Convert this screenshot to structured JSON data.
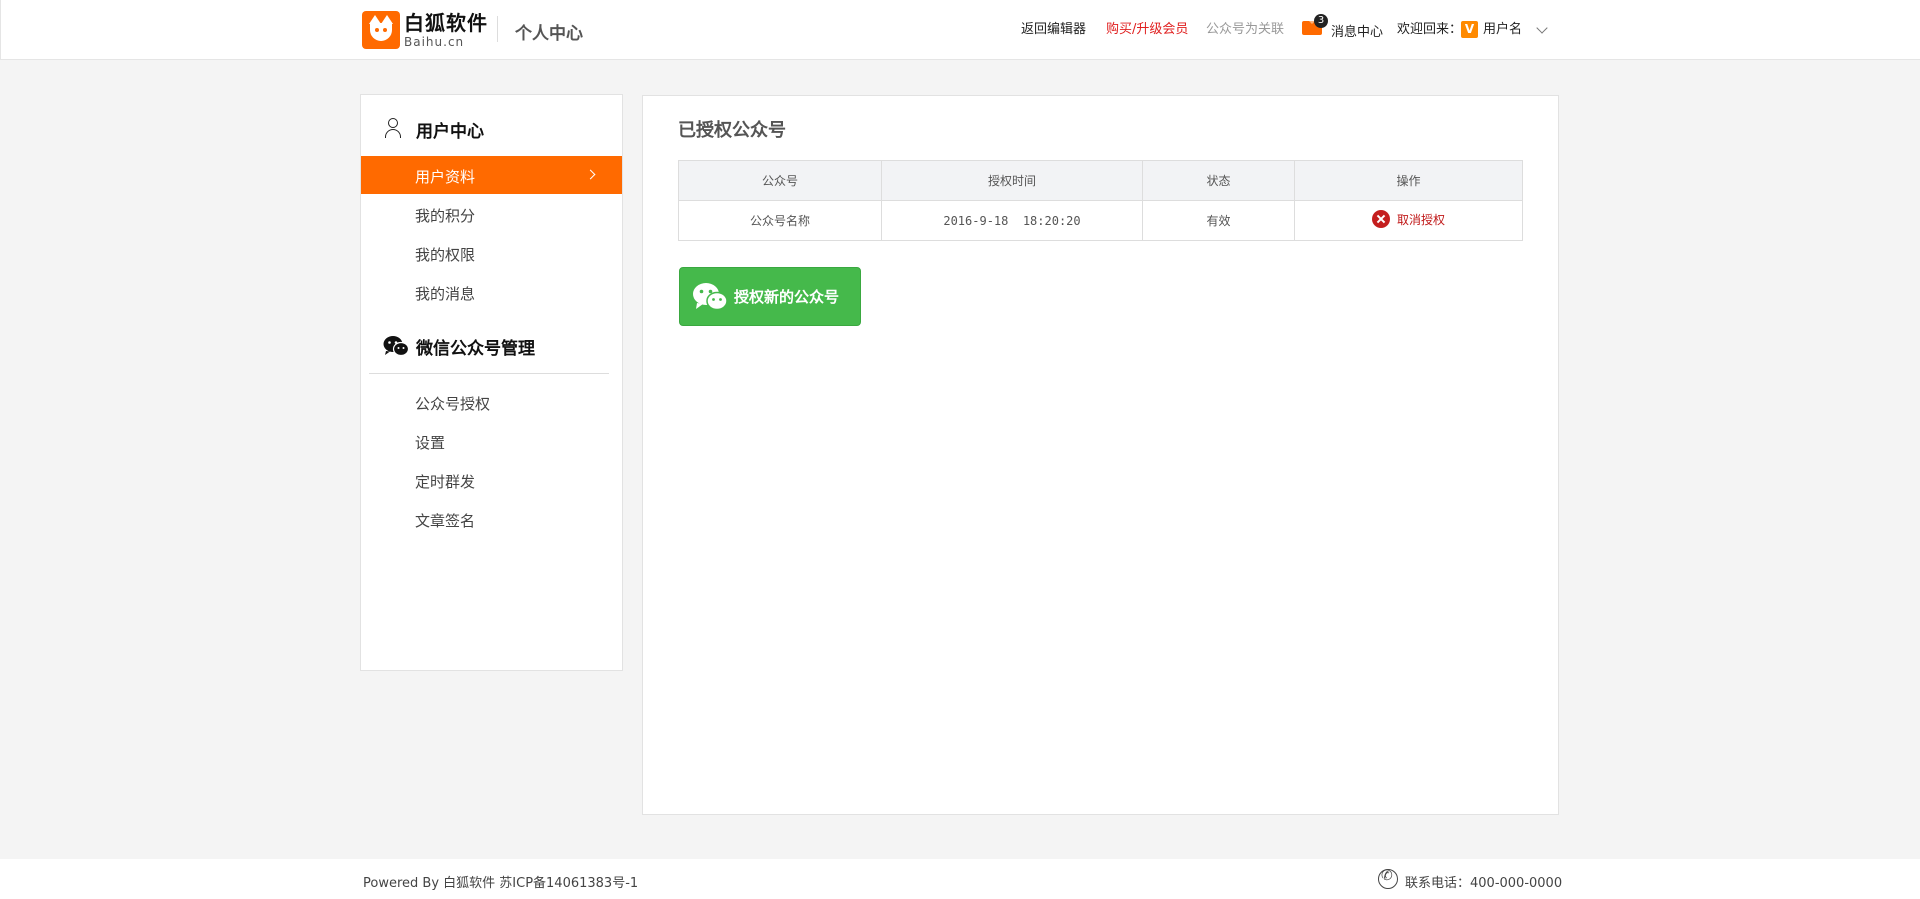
{
  "header": {
    "logo_cn": "白狐软件",
    "logo_en": "Baihu.cn",
    "title": "个人中心",
    "nav_back": "返回编辑器",
    "nav_buy": "购买/升级会员",
    "nav_wechat": "公众号为关联",
    "message_badge": "3",
    "message_label": "消息中心",
    "welcome": "欢迎回来：",
    "vip_letter": "V",
    "username": "用户名"
  },
  "sidebar": {
    "user_center_title": "用户中心",
    "user_items": [
      {
        "label": "用户资料",
        "active": true
      },
      {
        "label": "我的积分"
      },
      {
        "label": "我的权限"
      },
      {
        "label": "我的消息"
      }
    ],
    "wechat_title": "微信公众号管理",
    "wechat_items": [
      {
        "label": "公众号授权"
      },
      {
        "label": "设置"
      },
      {
        "label": "定时群发"
      },
      {
        "label": "文章签名"
      }
    ]
  },
  "main": {
    "title": "已授权公众号",
    "table": {
      "headers": [
        "公众号",
        "授权时间",
        "状态",
        "操作"
      ],
      "rows": [
        {
          "name": "公众号名称",
          "time": "2016-9-18  18:20:20",
          "status": "有效",
          "action": "取消授权"
        }
      ]
    },
    "auth_button": "授权新的公众号"
  },
  "footer": {
    "left": "Powered By 白狐软件 苏ICP备14061383号-1",
    "right": "联系电话：400-000-0000"
  },
  "colors": {
    "accent": "#ff6a00",
    "wechat_green": "#45b94b",
    "danger": "#c41e1e"
  }
}
